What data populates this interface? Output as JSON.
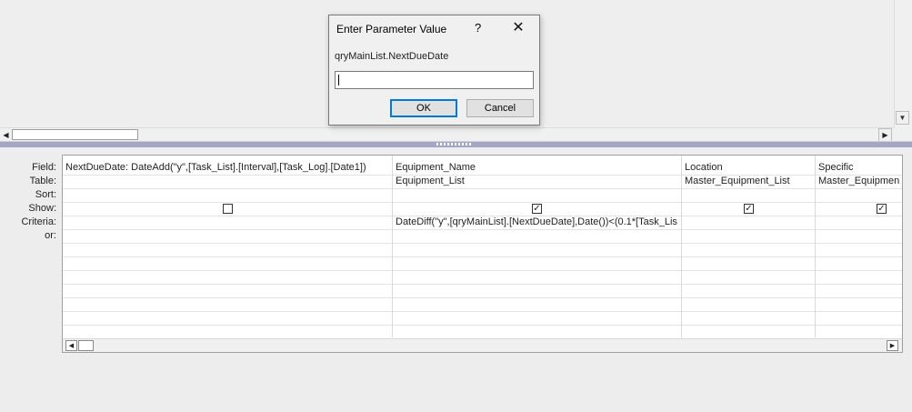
{
  "row_labels": [
    "Field:",
    "Table:",
    "Sort:",
    "Show:",
    "Criteria:",
    "or:"
  ],
  "columns": [
    {
      "field": "NextDueDate: DateAdd(\"y\",[Task_List].[Interval],[Task_Log].[Date1])",
      "table": "",
      "sort": "",
      "show": false,
      "criteria": ""
    },
    {
      "field": "Equipment_Name",
      "table": "Equipment_List",
      "sort": "",
      "show": true,
      "criteria": "DateDiff(\"y\",[qryMainList].[NextDueDate],Date())<(0.1*[Task_Lis"
    },
    {
      "field": "Location",
      "table": "Master_Equipment_List",
      "sort": "",
      "show": true,
      "criteria": ""
    },
    {
      "field": "Specific",
      "table": "Master_Equipmen",
      "sort": "",
      "show": true,
      "criteria": ""
    }
  ],
  "dialog": {
    "title": "Enter Parameter Value",
    "help_glyph": "?",
    "close_glyph": "✕",
    "prompt": "qryMainList.NextDueDate",
    "input_value": "",
    "ok_label": "OK",
    "cancel_label": "Cancel"
  },
  "glyphs": {
    "left": "◀",
    "right": "▶",
    "down": "▼",
    "check": "✓"
  }
}
